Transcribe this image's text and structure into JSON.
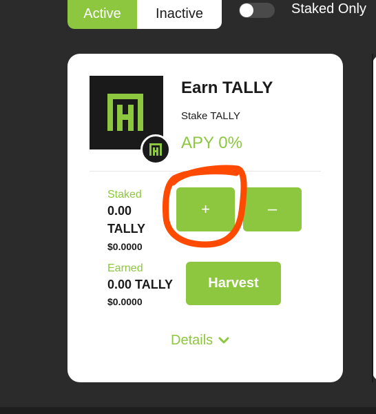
{
  "filters": {
    "active_label": "Active",
    "inactive_label": "Inactive",
    "staked_only_label": "Staked Only"
  },
  "farm_card": {
    "title": "Earn TALLY",
    "subtitle": "Stake TALLY",
    "apy": "APY 0%",
    "staked": {
      "label": "Staked",
      "amount": "0.00",
      "token": "TALLY",
      "usd": "$0.0000"
    },
    "earned": {
      "label": "Earned",
      "amount": "0.00 TALLY",
      "usd": "$0.0000"
    },
    "buttons": {
      "plus": "+",
      "minus": "–",
      "harvest": "Harvest"
    },
    "details_label": "Details",
    "logo_icon": "tally-logo-icon",
    "badge_icon": "tally-badge-icon"
  },
  "colors": {
    "accent_green": "#8dc63f",
    "annotation_orange": "#ff4a00",
    "background": "#2b2b2b"
  }
}
